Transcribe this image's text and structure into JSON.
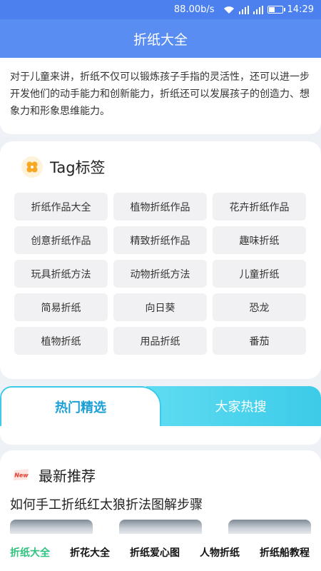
{
  "status_bar": {
    "speed": "88.00b/s",
    "time": "14:29"
  },
  "app_bar": {
    "title": "折纸大全"
  },
  "intro": {
    "text": "对于儿童来讲，折纸不仅可以锻炼孩子手指的灵活性，还可以进一步开发他们的动手能力和创新能力，折纸还可以发展孩子的创造力、想象力和形象思维能力。"
  },
  "tags": {
    "title": "Tag标签",
    "items": [
      "折纸作品大全",
      "植物折纸作品",
      "花卉折纸作品",
      "创意折纸作品",
      "精致折纸作品",
      "趣味折纸",
      "玩具折纸方法",
      "动物折纸方法",
      "儿童折纸",
      "简易折纸",
      "向日葵",
      "恐龙",
      "植物折纸",
      "用品折纸",
      "番茄"
    ]
  },
  "segments": {
    "left": "热门精选",
    "right": "大家热搜"
  },
  "recommend": {
    "title": "最新推荐",
    "badge": "New",
    "article_title": "如何手工折纸红太狼折法图解步骤"
  },
  "bottom_nav": {
    "items": [
      "折纸大全",
      "折花大全",
      "折纸爱心图",
      "人物折纸",
      "折纸船教程"
    ],
    "active_index": 0
  },
  "colors": {
    "primary": "#5a8df1",
    "status": "#4c80ee",
    "accent": "#3ccbe8",
    "active_nav": "#2ec27e"
  }
}
